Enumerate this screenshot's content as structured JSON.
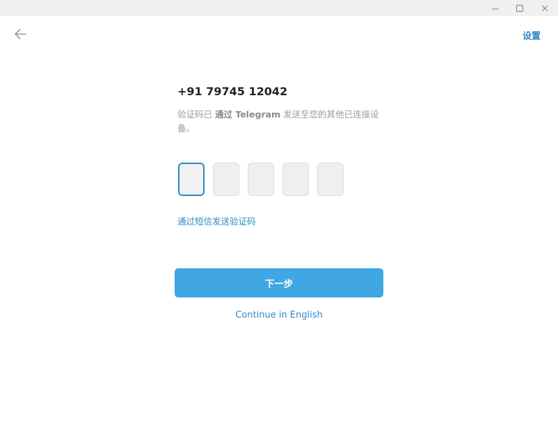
{
  "window": {
    "controls": {
      "minimize_icon": "minimize-icon",
      "maximize_icon": "maximize-icon",
      "close_icon": "close-icon"
    }
  },
  "header": {
    "back_icon": "arrow-left-icon",
    "settings_label": "设置"
  },
  "login": {
    "phone": "+91 79745 12042",
    "desc_before": "验证码已 ",
    "desc_bold": "通过 Telegram",
    "desc_after": " 发送至您的其他已连接设备。",
    "code_digits": [
      "",
      "",
      "",
      "",
      ""
    ],
    "sms_link": "通过短信发送验证码",
    "next_button": "下一步",
    "english_link": "Continue in English"
  },
  "colors": {
    "accent": "#2e88c6",
    "button_bg": "#40a7e3",
    "titlebar_bg": "#f0f0f0"
  }
}
